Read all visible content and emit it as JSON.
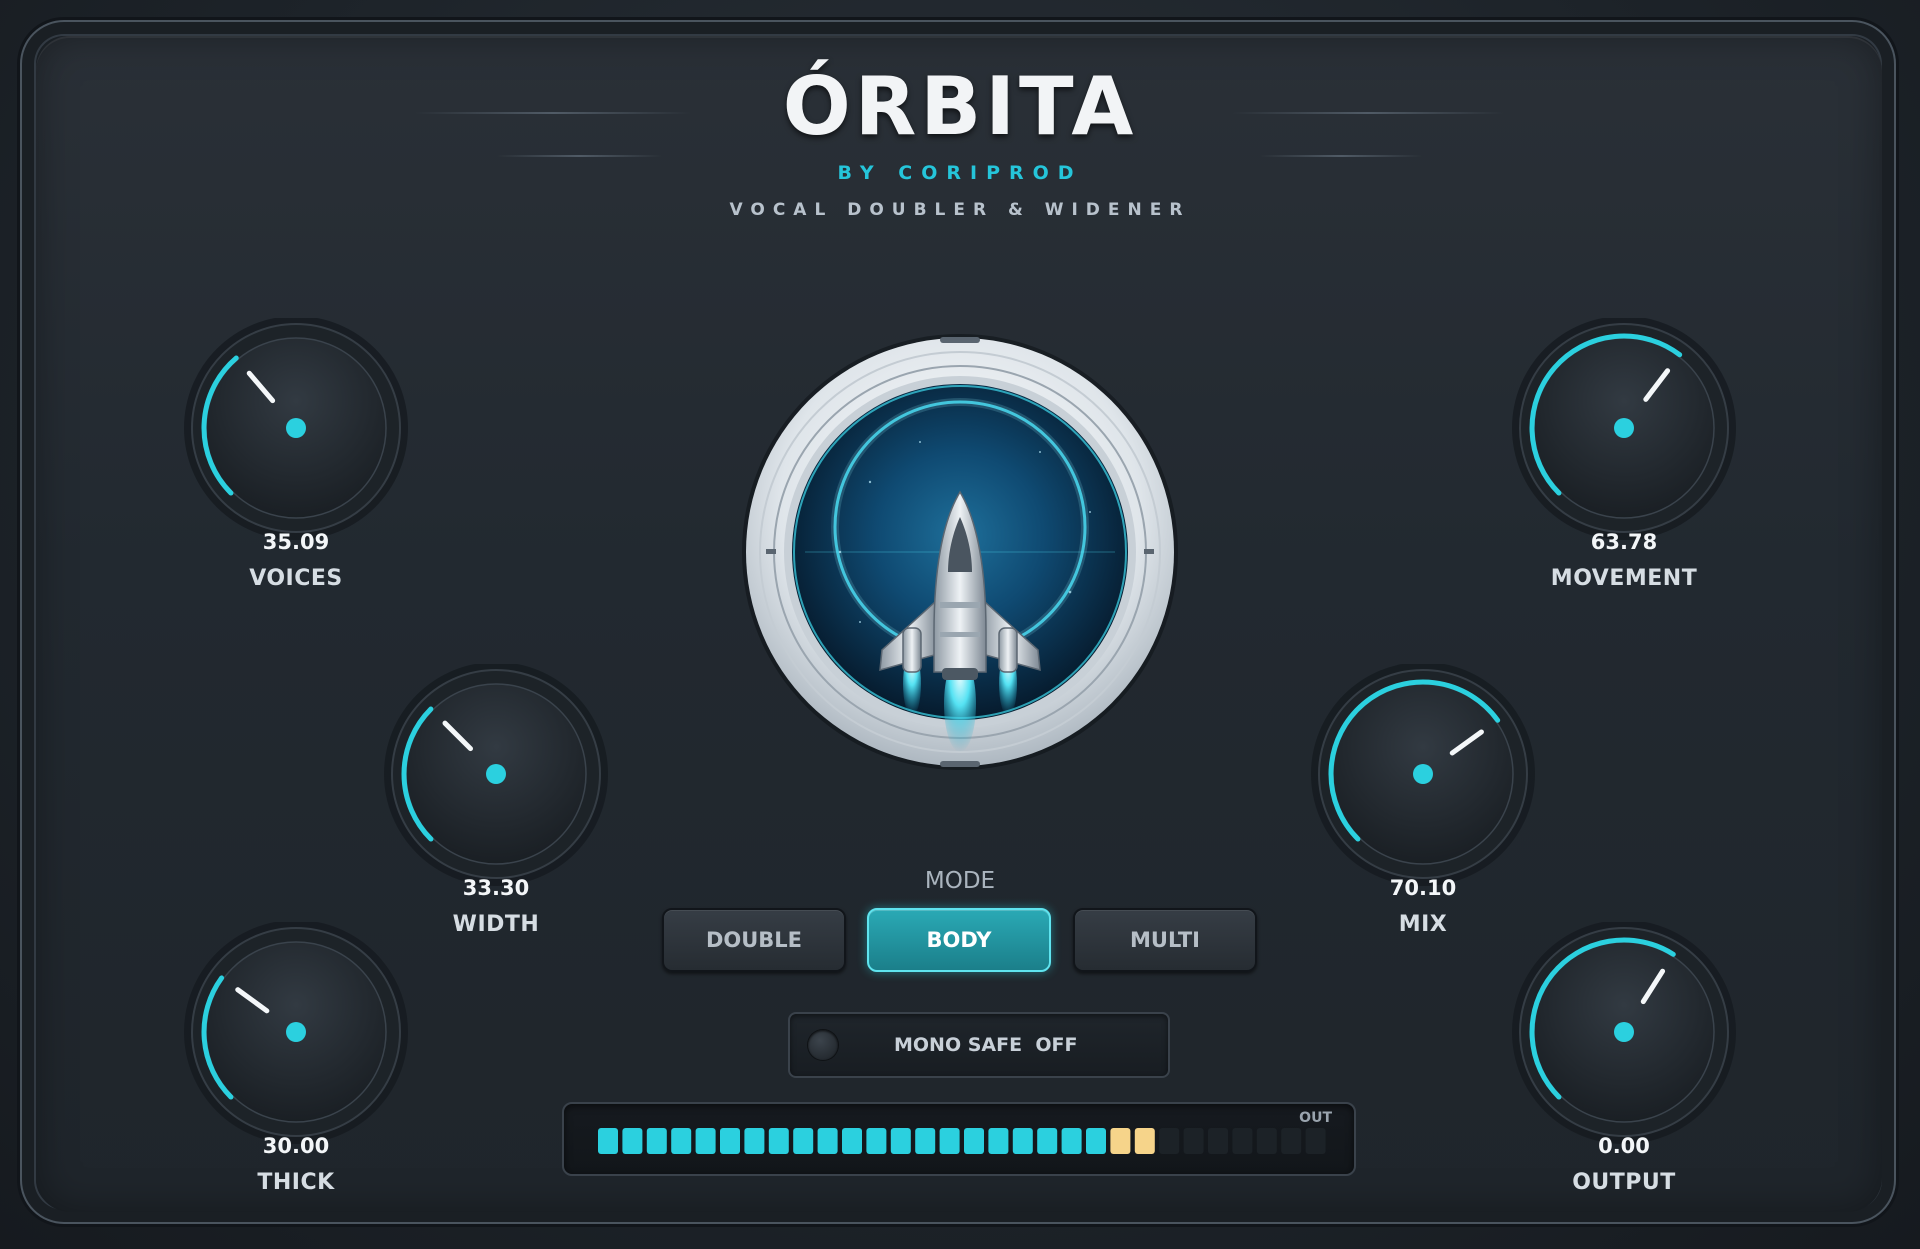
{
  "header": {
    "title": "ÓRBITA",
    "byline": "BY CORIPROD",
    "subtitle": "VOCAL DOUBLER & WIDENER"
  },
  "colors": {
    "accent": "#2bd0df",
    "active_mode": "#2aa9b5",
    "meter_warm": "#f6d48a",
    "panel": "#232a31"
  },
  "knobs": [
    {
      "id": "voices",
      "label": "VOICES",
      "value": "35.09",
      "level": 0.35
    },
    {
      "id": "width",
      "label": "WIDTH",
      "value": "33.30",
      "level": 0.333
    },
    {
      "id": "thick",
      "label": "THICK",
      "value": "30.00",
      "level": 0.3
    },
    {
      "id": "movement",
      "label": "MOVEMENT",
      "value": "63.78",
      "level": 0.638
    },
    {
      "id": "mix",
      "label": "MIX",
      "value": "70.10",
      "level": 0.701
    },
    {
      "id": "output",
      "label": "OUTPUT",
      "value": "0.00",
      "level": 0.62
    }
  ],
  "mode": {
    "label": "MODE",
    "options": [
      "DOUBLE",
      "BODY",
      "MULTI"
    ],
    "selected": "BODY"
  },
  "mono_safe": {
    "label": "MONO SAFE",
    "state": "OFF"
  },
  "meter": {
    "label": "OUT",
    "total_cells": 30,
    "lit_cyan": 21,
    "lit_warm": 2
  },
  "icons": {
    "center": "spaceship-icon"
  }
}
